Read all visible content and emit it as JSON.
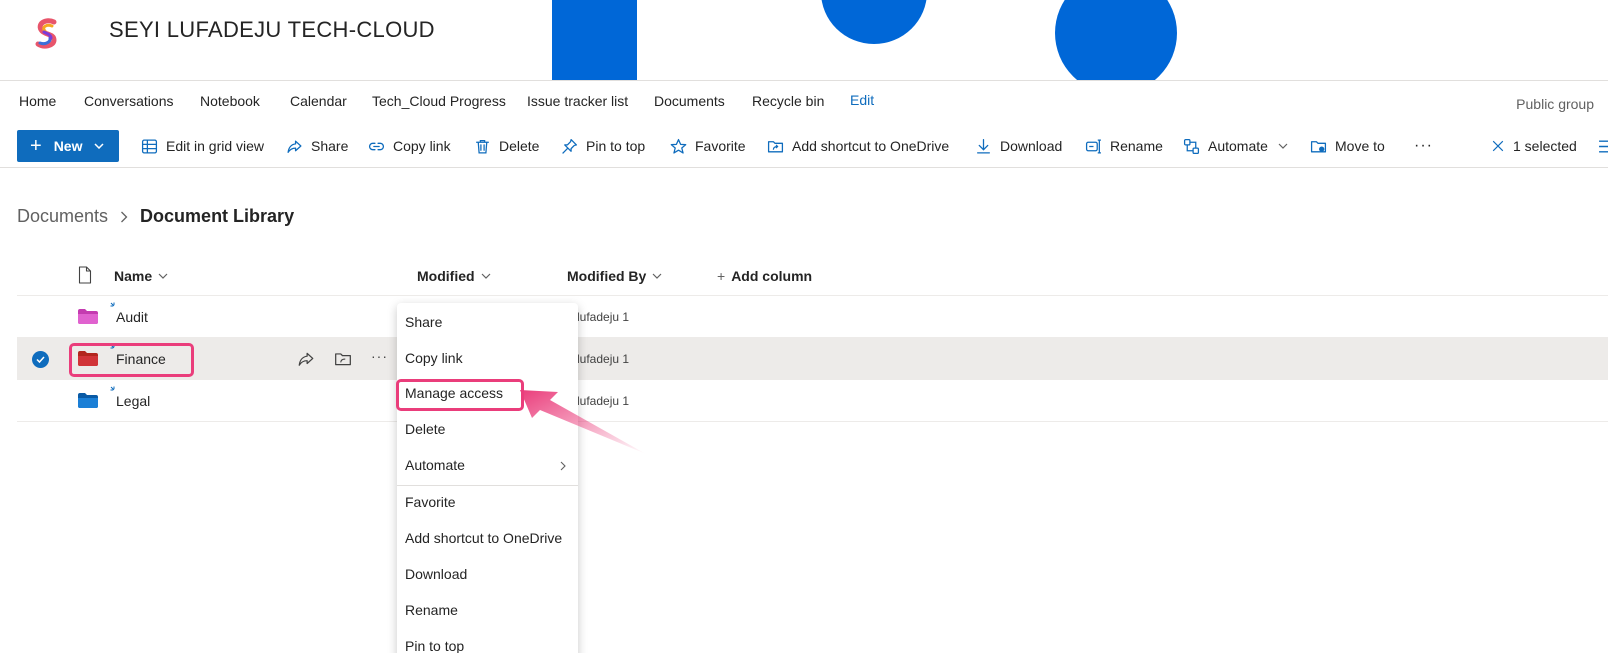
{
  "header": {
    "site_title": "SEYI LUFADEJU TECH-CLOUD"
  },
  "nav": {
    "items": [
      "Home",
      "Conversations",
      "Notebook",
      "Calendar",
      "Tech_Cloud Progress",
      "Issue tracker list",
      "Documents",
      "Recycle bin"
    ],
    "edit_label": "Edit",
    "public_group": "Public group"
  },
  "commandbar": {
    "new_label": "New",
    "edit_grid": "Edit in grid view",
    "share": "Share",
    "copy_link": "Copy link",
    "delete": "Delete",
    "pin_to_top": "Pin to top",
    "favorite": "Favorite",
    "add_shortcut": "Add shortcut to OneDrive",
    "download": "Download",
    "rename": "Rename",
    "automate": "Automate",
    "move_to": "Move to",
    "more": "···",
    "selected": "1 selected"
  },
  "breadcrumb": {
    "root": "Documents",
    "current": "Document Library"
  },
  "columns": {
    "name": "Name",
    "modified": "Modified",
    "modified_by": "Modified By",
    "add_column": "Add column"
  },
  "rows": [
    {
      "name": "Audit",
      "modified_by": "yi lufadeju 1",
      "folder_color": "#c43bb0"
    },
    {
      "name": "Finance",
      "modified_by": "yi lufadeju 1",
      "folder_color": "#d13438"
    },
    {
      "name": "Legal",
      "modified_by": "yi lufadeju 1",
      "folder_color": "#0f6cbd"
    }
  ],
  "context_menu": {
    "items": [
      "Share",
      "Copy link",
      "Manage access",
      "Delete",
      "Automate",
      "Favorite",
      "Add shortcut to OneDrive",
      "Download",
      "Rename",
      "Pin to top"
    ]
  },
  "colors": {
    "accent": "#0f6cbd",
    "highlight": "#ea3d7b",
    "deco_blue": "#0067d7"
  }
}
